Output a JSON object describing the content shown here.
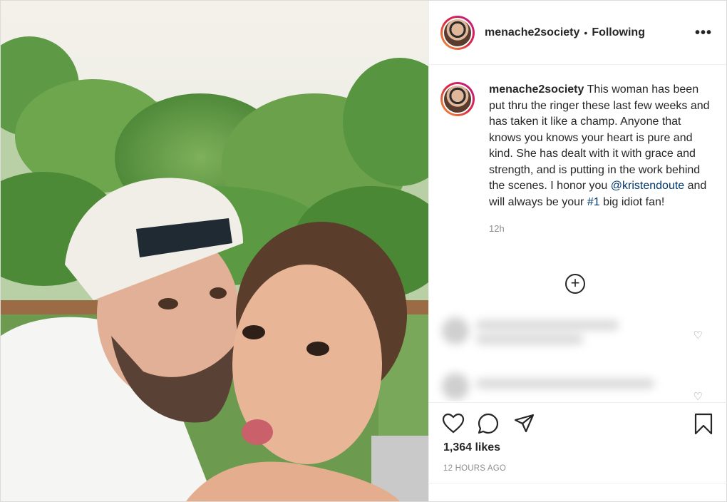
{
  "post": {
    "username": "menache2society",
    "separator": "•",
    "follow_status": "Following",
    "more_icon": "•••",
    "caption": {
      "username": "menache2society",
      "text_1": " This woman has been put thru the ringer these last few weeks and has taken it like a champ. Anyone that knows you knows your heart is pure and kind. She has dealt with it with grace and strength, and is putting in the work behind the scenes. I honor you ",
      "mention": "@kristendoute",
      "text_2": " and will always be your ",
      "hashtag": "#1",
      "text_3": " big idiot fan!"
    },
    "caption_time": "12h",
    "load_more_icon": "+",
    "likes": "1,364 likes",
    "timestamp": "12 HOURS AGO"
  },
  "colors": {
    "link": "#00376b",
    "muted": "#8e8e8e",
    "text": "#262626"
  }
}
